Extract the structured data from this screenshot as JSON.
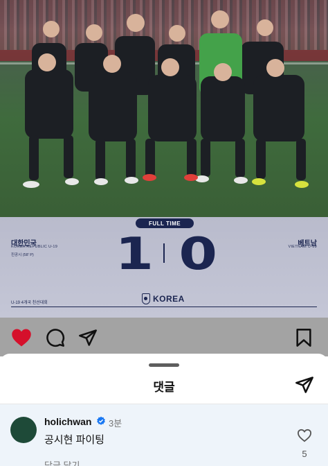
{
  "post": {
    "image": {
      "badge": "FULL TIME",
      "home_team_ko": "대한민국",
      "home_team_en": "KOREA REPUBLIC U-19",
      "scorer": "진공시 (58' P)",
      "home_score": "1",
      "away_score": "0",
      "away_team_ko": "베트남",
      "away_team_en": "VIETNAM U-19",
      "tournament": "U-19 4개국 친선대회",
      "brand": "KOREA"
    },
    "actions": {
      "liked": true,
      "like_icon": "heart-filled-icon",
      "comment_icon": "comment-icon",
      "share_icon": "send-icon",
      "save_icon": "bookmark-icon",
      "like_color": "#d5102b"
    }
  },
  "comments_sheet": {
    "title": "댓글",
    "send_icon": "send-icon",
    "comments": [
      {
        "username": "holichwan",
        "verified": true,
        "time": "3분",
        "text": "공시현 파이팅",
        "reply_label": "답글 달기",
        "like_count": "5"
      }
    ]
  }
}
